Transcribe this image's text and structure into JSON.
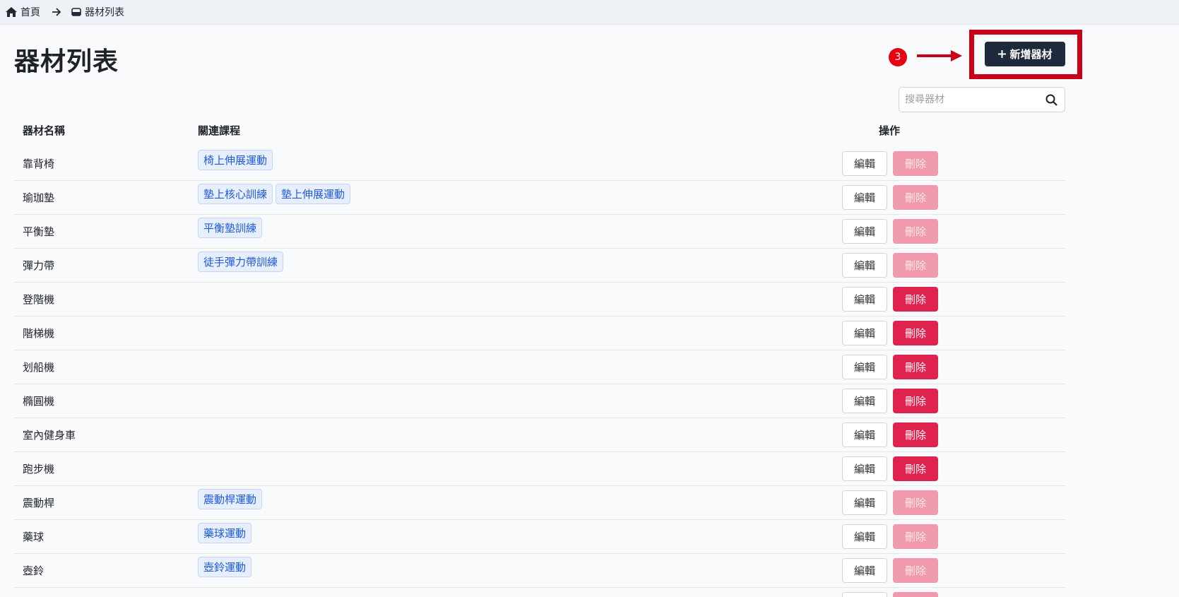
{
  "breadcrumb": {
    "home": "首頁",
    "current": "器材列表"
  },
  "page": {
    "title": "器材列表"
  },
  "annotation": {
    "step_number": "3"
  },
  "toolbar": {
    "add_label": "新增器材",
    "search_placeholder": "搜尋器材"
  },
  "table": {
    "headers": {
      "name": "器材名稱",
      "courses": "關連課程",
      "ops": "操作"
    },
    "edit_label": "編輯",
    "delete_label": "刪除",
    "rows": [
      {
        "name": "靠背椅",
        "courses": [
          "椅上伸展運動"
        ],
        "delete_disabled": true
      },
      {
        "name": "瑜珈墊",
        "courses": [
          "墊上核心訓練",
          "墊上伸展運動"
        ],
        "delete_disabled": true
      },
      {
        "name": "平衡墊",
        "courses": [
          "平衡墊訓練"
        ],
        "delete_disabled": true
      },
      {
        "name": "彈力帶",
        "courses": [
          "徒手彈力帶訓練"
        ],
        "delete_disabled": true
      },
      {
        "name": "登階機",
        "courses": [],
        "delete_disabled": false
      },
      {
        "name": "階梯機",
        "courses": [],
        "delete_disabled": false
      },
      {
        "name": "划船機",
        "courses": [],
        "delete_disabled": false
      },
      {
        "name": "橢圓機",
        "courses": [],
        "delete_disabled": false
      },
      {
        "name": "室內健身車",
        "courses": [],
        "delete_disabled": false
      },
      {
        "name": "跑步機",
        "courses": [],
        "delete_disabled": false
      },
      {
        "name": "震動桿",
        "courses": [
          "震動桿運動"
        ],
        "delete_disabled": true
      },
      {
        "name": "藥球",
        "courses": [
          "藥球運動"
        ],
        "delete_disabled": true
      },
      {
        "name": "壺鈴",
        "courses": [
          "壺鈴運動"
        ],
        "delete_disabled": true
      }
    ]
  },
  "colors": {
    "primary_dark": "#1e293b",
    "danger": "#e0234e",
    "danger_disabled": "#f19aab",
    "tag_text": "#1f5bd6",
    "annotation_red": "#c8001a"
  }
}
